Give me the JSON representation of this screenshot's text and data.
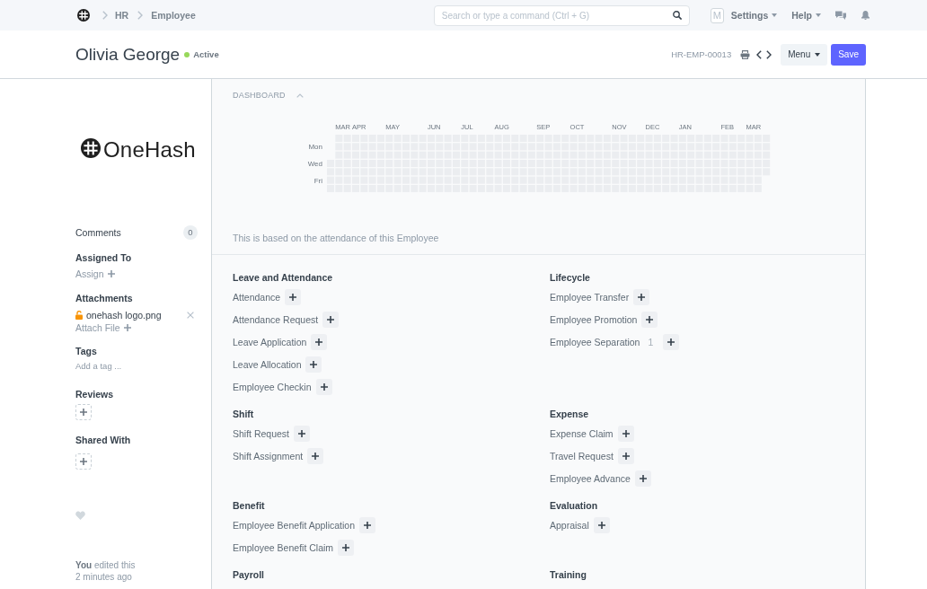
{
  "navbar": {
    "breadcrumbs": [
      "HR",
      "Employee"
    ],
    "search": {
      "placeholder": "Search or type a command (Ctrl + G)"
    },
    "avatar": "M",
    "menus": [
      "Settings",
      "Help"
    ]
  },
  "header": {
    "title": "Olivia George",
    "status": {
      "label": "Active",
      "color": "#98d85b"
    },
    "doc_id": "HR-EMP-00013",
    "buttons": [
      {
        "label": "Menu",
        "kind": "dropdown"
      },
      {
        "label": "Save",
        "kind": "primary"
      }
    ]
  },
  "sidebar": {
    "logo_text": "OneHash",
    "comments": {
      "label": "Comments",
      "count": "0"
    },
    "assigned_to": {
      "label": "Assigned To",
      "action": "Assign"
    },
    "attachments": {
      "label": "Attachments",
      "files": [
        "onehash logo.png"
      ],
      "action": "Attach File"
    },
    "tags": {
      "label": "Tags",
      "action": "Add a tag ..."
    },
    "reviews": {
      "label": "Reviews"
    },
    "shared_with": {
      "label": "Shared With"
    },
    "activity": {
      "text": "**You** edited this",
      "time": "2 minutes ago"
    }
  },
  "dashboard": {
    "title": "DASHBOARD",
    "expanded": true,
    "heatmap": {
      "months": [
        "MAR",
        "APR",
        "MAY",
        "JUN",
        "JUL",
        "AUG",
        "SEP",
        "OCT",
        "NOV",
        "DEC",
        "JAN",
        "FEB",
        "MAR"
      ],
      "weekdays": [
        "Mon",
        "Wed",
        "Fri"
      ]
    },
    "note": "This is based on the attendance of this Employee"
  },
  "links": [
    {
      "title": "Leave and Attendance",
      "items": [
        {
          "label": "Attendance"
        },
        {
          "label": "Attendance Request"
        },
        {
          "label": "Leave Application"
        },
        {
          "label": "Leave Allocation"
        },
        {
          "label": "Employee Checkin"
        }
      ]
    },
    {
      "title": "Lifecycle",
      "items": [
        {
          "label": "Employee Transfer"
        },
        {
          "label": "Employee Promotion"
        },
        {
          "label": "Employee Separation",
          "count": "1"
        }
      ]
    },
    {
      "title": "Shift",
      "items": [
        {
          "label": "Shift Request"
        },
        {
          "label": "Shift Assignment"
        }
      ]
    },
    {
      "title": "Expense",
      "items": [
        {
          "label": "Expense Claim"
        },
        {
          "label": "Travel Request"
        },
        {
          "label": "Employee Advance"
        }
      ]
    },
    {
      "title": "Benefit",
      "items": [
        {
          "label": "Employee Benefit Application"
        },
        {
          "label": "Employee Benefit Claim"
        }
      ]
    },
    {
      "title": "Evaluation",
      "items": [
        {
          "label": "Appraisal"
        }
      ]
    },
    {
      "title": "Payroll"
    },
    {
      "title": "Training"
    }
  ]
}
